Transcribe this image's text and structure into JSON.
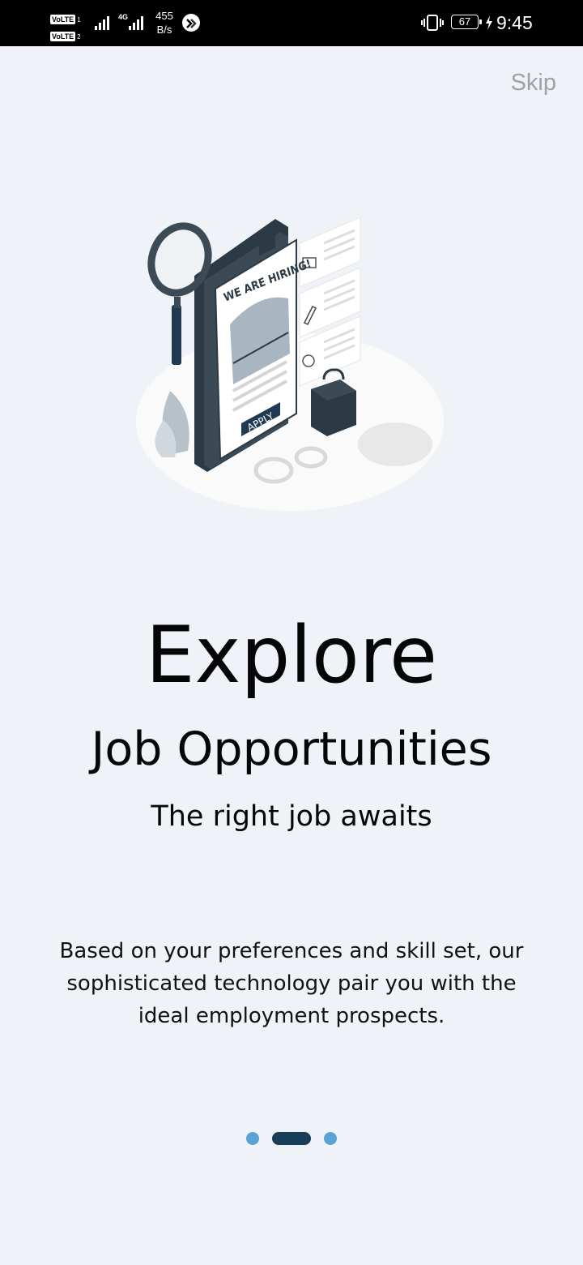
{
  "status_bar": {
    "volte_1": "VoLTE",
    "sim_1": "1",
    "volte_2": "VoLTE",
    "sim_2": "2",
    "network_type": "4G",
    "speed_value": "455",
    "speed_unit": "B/s",
    "battery_level": "67",
    "time": "9:45",
    "icons": [
      "signal-icon",
      "cast-icon",
      "vibrate-icon",
      "charging-icon"
    ]
  },
  "onboarding": {
    "skip_label": "Skip",
    "illustration": {
      "hiring_text": "WE ARE HIRING!",
      "apply_text": "APPLY"
    },
    "title": "Explore",
    "subtitle": "Job Opportunities",
    "tagline": "The right job awaits",
    "description": "Based on your preferences and skill set, our sophisticated technology pair you with the ideal employment prospects.",
    "pagination": {
      "total": 3,
      "active_index": 1
    },
    "colors": {
      "background": "#eff3f8",
      "dot_active": "#173d57",
      "dot_inactive": "#5aa3d6",
      "skip_text": "#9ea2a6"
    }
  }
}
